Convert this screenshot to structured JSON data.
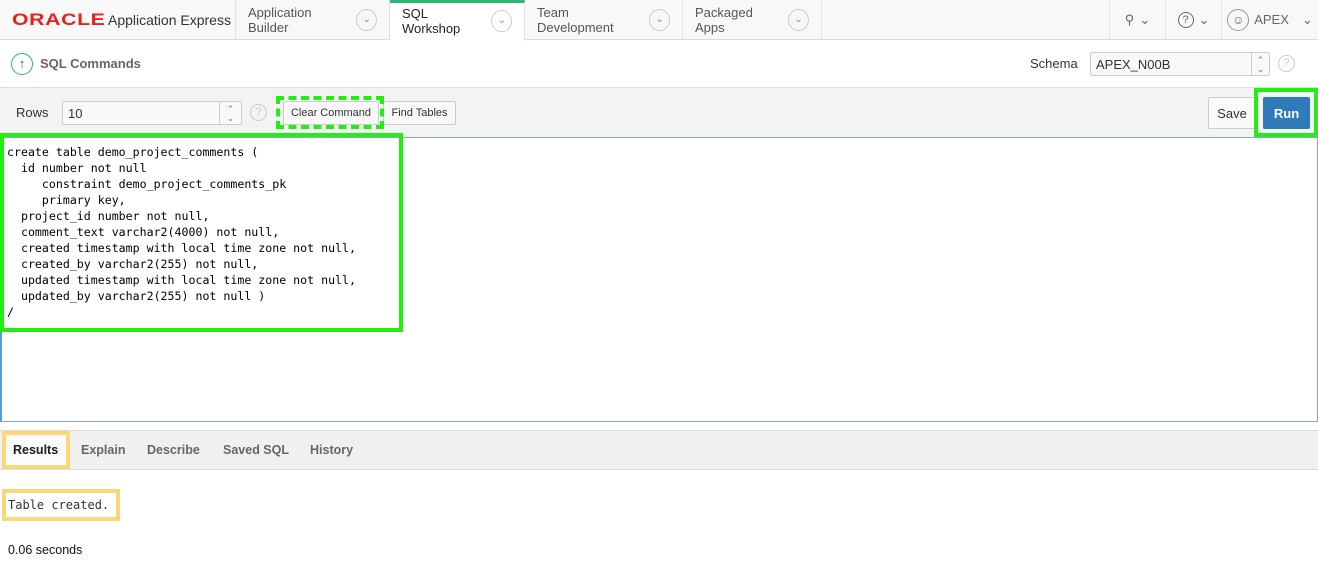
{
  "nav": {
    "brand": "ORACLE",
    "product": "Application Express",
    "tabs": [
      {
        "label": "Application Builder"
      },
      {
        "label": "SQL Workshop"
      },
      {
        "label": "Team Development"
      },
      {
        "label": "Packaged Apps"
      }
    ],
    "user": "APEX"
  },
  "page": {
    "title": "SQL Commands",
    "schema_label": "Schema",
    "schema_value": "APEX_N00B"
  },
  "toolbar": {
    "rows_label": "Rows",
    "rows_value": "10",
    "clear": "Clear Command",
    "find": "Find Tables",
    "save": "Save",
    "run": "Run"
  },
  "editor": {
    "lines": [
      "create table demo_project_comments (",
      "  id number not null",
      "     constraint demo_project_comments_pk",
      "     primary key,",
      "  project_id number not null,",
      "  comment_text varchar2(4000) not null,",
      "  created timestamp with local time zone not null,",
      "  created_by varchar2(255) not null,",
      "  updated timestamp with local time zone not null,",
      "  updated_by varchar2(255) not null )",
      "/"
    ]
  },
  "results": {
    "tabs": [
      "Results",
      "Explain",
      "Describe",
      "Saved SQL",
      "History"
    ],
    "message": "Table created.",
    "time": "0.06 seconds"
  },
  "colors": {
    "accent": "#2bb673",
    "run": "#2f7ab9",
    "highlight_green": "#22ee11",
    "highlight_yellow": "#fdd675"
  }
}
